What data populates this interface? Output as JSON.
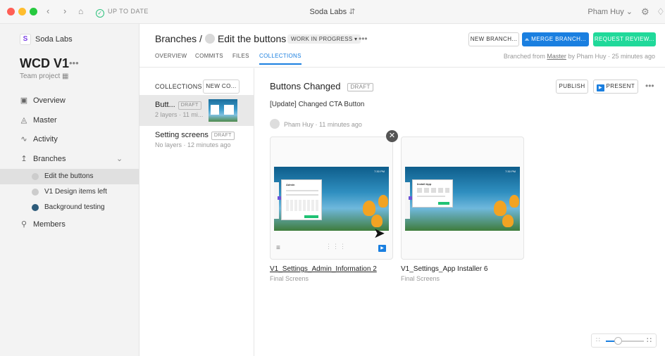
{
  "titlebar": {
    "status": "UP TO DATE",
    "window_title": "Soda Labs",
    "user": "Pham Huy",
    "colors": {
      "close": "#ff5f56",
      "minimize": "#ffbd2e",
      "zoom": "#27c93f"
    }
  },
  "sidebar": {
    "org_name": "Soda Labs",
    "project_name": "WCD V1",
    "project_type": "Team project",
    "nav": {
      "overview": "Overview",
      "master": "Master",
      "activity": "Activity",
      "branches": "Branches",
      "members": "Members"
    },
    "branches": {
      "b1": "Edit the buttons",
      "b2": "V1 Design items left",
      "b3": "Background testing"
    }
  },
  "header": {
    "breadcrumb_root": "Branches",
    "breadcrumb_sep": "/",
    "branch_name": "Edit the buttons",
    "status": "WORK IN PROGRESS ▾",
    "new_branch": "NEW BRANCH...",
    "merge_branch": "MERGE BRANCH...",
    "request_review": "REQUEST REVIEW...",
    "tabs": {
      "overview": "OVERVIEW",
      "commits": "COMMITS",
      "files": "FILES",
      "collections": "COLLECTIONS"
    },
    "branched_prefix": "Branched from",
    "branched_master": "Master",
    "branched_suffix": "by Pham Huy · 25 minutes ago",
    "accent": "#1a7fe0",
    "review_color": "#20d99a"
  },
  "collections": {
    "title": "COLLECTIONS",
    "new_button": "NEW CO...",
    "items": {
      "i1": {
        "name": "Butt...",
        "badge": "DRAFT",
        "meta": "2 layers · 11 mi..."
      },
      "i2": {
        "name": "Setting screens",
        "badge": "DRAFT",
        "meta": "No layers · 12 minutes ago"
      }
    }
  },
  "main": {
    "title": "Buttons Changed",
    "badge": "DRAFT",
    "publish": "PUBLISH",
    "present": "PRESENT",
    "description": "[Update] Changed CTA Button",
    "author": "Pham Huy · 11 minutes ago",
    "cards": {
      "c1": {
        "name": "V1_Settings_Admin_Information 2",
        "group": "Final Screens",
        "panel_title": "Admin",
        "time": "7:30 PM"
      },
      "c2": {
        "name": "V1_Settings_App Installer 6",
        "group": "Final Screens",
        "panel_title": "Install App",
        "time": "7:30 PM"
      }
    }
  }
}
